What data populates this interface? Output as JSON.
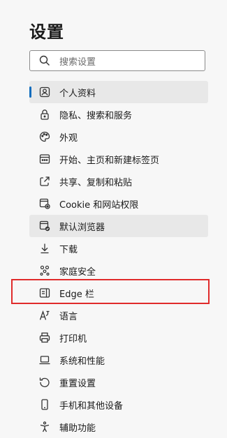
{
  "header": {
    "title": "设置"
  },
  "search": {
    "placeholder": "搜索设置",
    "icon": "search-icon"
  },
  "colors": {
    "accent": "#0f6cbd",
    "highlight": "#e02b2b"
  },
  "sidebar": {
    "items": [
      {
        "label": "个人资料",
        "icon": "profile-icon"
      },
      {
        "label": "隐私、搜索和服务",
        "icon": "lock-icon"
      },
      {
        "label": "外观",
        "icon": "palette-icon"
      },
      {
        "label": "开始、主页和新建标签页",
        "icon": "home-window-icon"
      },
      {
        "label": "共享、复制和粘贴",
        "icon": "share-icon"
      },
      {
        "label": "Cookie 和网站权限",
        "icon": "site-permissions-icon"
      },
      {
        "label": "默认浏览器",
        "icon": "default-browser-icon"
      },
      {
        "label": "下载",
        "icon": "download-icon"
      },
      {
        "label": "家庭安全",
        "icon": "family-icon"
      },
      {
        "label": "Edge 栏",
        "icon": "edge-bar-icon"
      },
      {
        "label": "语言",
        "icon": "language-icon"
      },
      {
        "label": "打印机",
        "icon": "printer-icon"
      },
      {
        "label": "系统和性能",
        "icon": "laptop-icon"
      },
      {
        "label": "重置设置",
        "icon": "reset-icon"
      },
      {
        "label": "手机和其他设备",
        "icon": "phone-icon"
      },
      {
        "label": "辅助功能",
        "icon": "accessibility-icon"
      }
    ]
  }
}
